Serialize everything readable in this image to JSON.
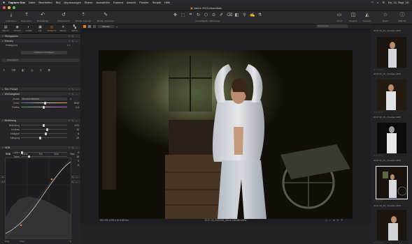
{
  "menubar": {
    "app": "Capture One",
    "items": [
      "Datei",
      "Bearbeiten",
      "Bild",
      "Anpassungen",
      "Ebene",
      "Auswählen",
      "Kamera",
      "Ansicht",
      "Fenster",
      "Skripte",
      "Hilfe"
    ],
    "clock": "Do. 14. Sept. 18:"
  },
  "window": {
    "title": "Jarine 2023-essentials"
  },
  "toolbar": {
    "import_label": "Importieren",
    "export_label": "Exportieren",
    "undo_label": "Rückgängig",
    "reset_label": "Zurücksetzen",
    "copy_label": "Einstlg. kopieren",
    "apply_label": "Einstlg. anwenden",
    "cursor_label": "Auswahlgriffe / Werkzeuge",
    "styles_label": "Stile",
    "proof_label": "Proof",
    "compare_label": "Vergleich",
    "recipes_label": "Rezepte",
    "later_label": "Später",
    "help_label": "Hilfe/Info"
  },
  "tool_tabs": [
    {
      "label": "BIBLIOT",
      "icon": "▤"
    },
    {
      "label": "TETHER",
      "icon": "◉"
    },
    {
      "label": "FARBE",
      "icon": "◐"
    },
    {
      "label": "EBL",
      "icon": "▣"
    },
    {
      "label": "OBJEKTIV",
      "icon": "◎"
    },
    {
      "label": "BELICH",
      "icon": "☀"
    },
    {
      "label": "VERSTL",
      "icon": "▚"
    }
  ],
  "viewer": {
    "tab_label": "Variante",
    "search_placeholder": "Eingepasst",
    "meta": "ISO 200  1/250 s  f/1.8  85 mm",
    "filename": "20-07-23_20U2006_Jarine-Kriestlen.ARW",
    "icons": "▢ ◇ ⊕ ✎ ☰"
  },
  "left_panel": {
    "histogram": "Histogramm",
    "layers": "Ebenen",
    "background_label": "Hintergrund",
    "add_layer": "Füllebene hinzufügen",
    "layer_name": "Hintergrund",
    "white_balance": "Weißabgleich",
    "mode_label": "Modus",
    "mode_value": "Benutzerdefiniert",
    "kelvin_label": "Kelvin",
    "kelvin_value": "5022",
    "tint_label": "Farbton",
    "tint_value": "-1,4",
    "film": "Stil / Preset",
    "exposure": "Belichtung",
    "sliders_exposure": [
      {
        "label": "Belichtung",
        "value": "-0,21"
      },
      {
        "label": "Kontrast",
        "value": "10"
      },
      {
        "label": "Helligkeit",
        "value": "6"
      },
      {
        "label": "Sättigung",
        "value": "-20"
      }
    ],
    "hdr": "HDR",
    "sliders_hdr": [
      {
        "label": "Lichter",
        "value": "0"
      },
      {
        "label": "Tiefen",
        "value": "15"
      },
      {
        "label": "Weiß",
        "value": "0"
      },
      {
        "label": "Schwarz",
        "value": "0"
      }
    ],
    "tone": "Tonwerte",
    "curve": "Kurve",
    "curve_tabs": [
      "RGB",
      "Luma",
      "Rot",
      "Grün",
      "Blau"
    ],
    "curve_in": "Eing.",
    "curve_out": "Ausg."
  },
  "browser": {
    "captions": [
      "20-07-23_20_.Kriestlen.ARW",
      "20-07-23_20_.Kriestlen.ARW",
      "20-07-23_20_.Kriestlen.ARW",
      "20-07-23_20_.Kriestlen.ARW",
      "20-07-23_20_.Kriestlen.ARW",
      "20-07-23_20_.Kriestlen.ARW"
    ]
  },
  "colors": {
    "accent": "#e07a28",
    "background": "#1b1b1c",
    "panel": "#252527"
  }
}
